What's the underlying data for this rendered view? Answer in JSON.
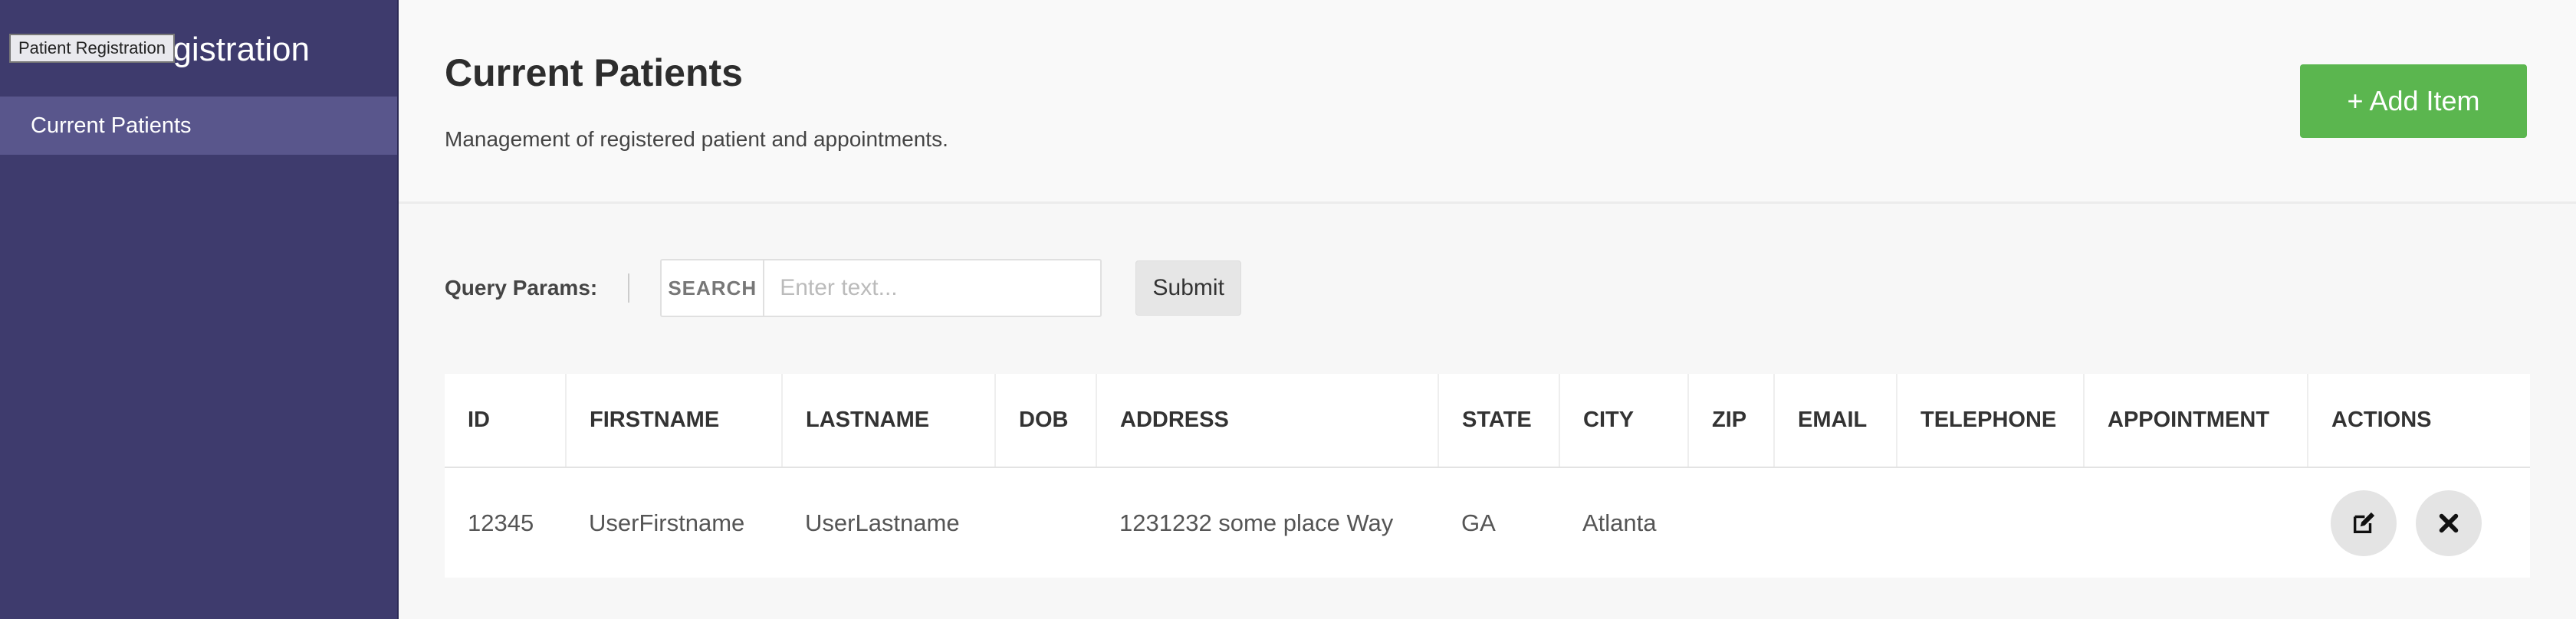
{
  "sidebar": {
    "title": "Patient Registration",
    "tooltip": "Patient Registration",
    "items": [
      {
        "label": "Current Patients"
      }
    ]
  },
  "header": {
    "title": "Current Patients",
    "subtitle": "Management of registered patient and appointments.",
    "add_button": "+ Add Item"
  },
  "query": {
    "label": "Query Params:",
    "search_addon": "SEARCH",
    "search_placeholder": "Enter text...",
    "search_value": "",
    "submit": "Submit"
  },
  "table": {
    "columns": [
      "ID",
      "FIRSTNAME",
      "LASTNAME",
      "DOB",
      "ADDRESS",
      "STATE",
      "CITY",
      "ZIP",
      "EMAIL",
      "TELEPHONE",
      "APPOINTMENT",
      "ACTIONS"
    ],
    "rows": [
      {
        "id": "12345",
        "firstname": "UserFirstname",
        "lastname": "UserLastname",
        "dob": "",
        "address": "1231232 some place Way",
        "state": "GA",
        "city": "Atlanta",
        "zip": "",
        "email": "",
        "telephone": "",
        "appointment": ""
      }
    ]
  },
  "icons": {
    "edit": "edit-icon",
    "delete": "close-icon"
  },
  "colors": {
    "sidebar": "#3e3b6d",
    "sidebar_active": "#59568c",
    "add_button": "#5bb64f"
  }
}
